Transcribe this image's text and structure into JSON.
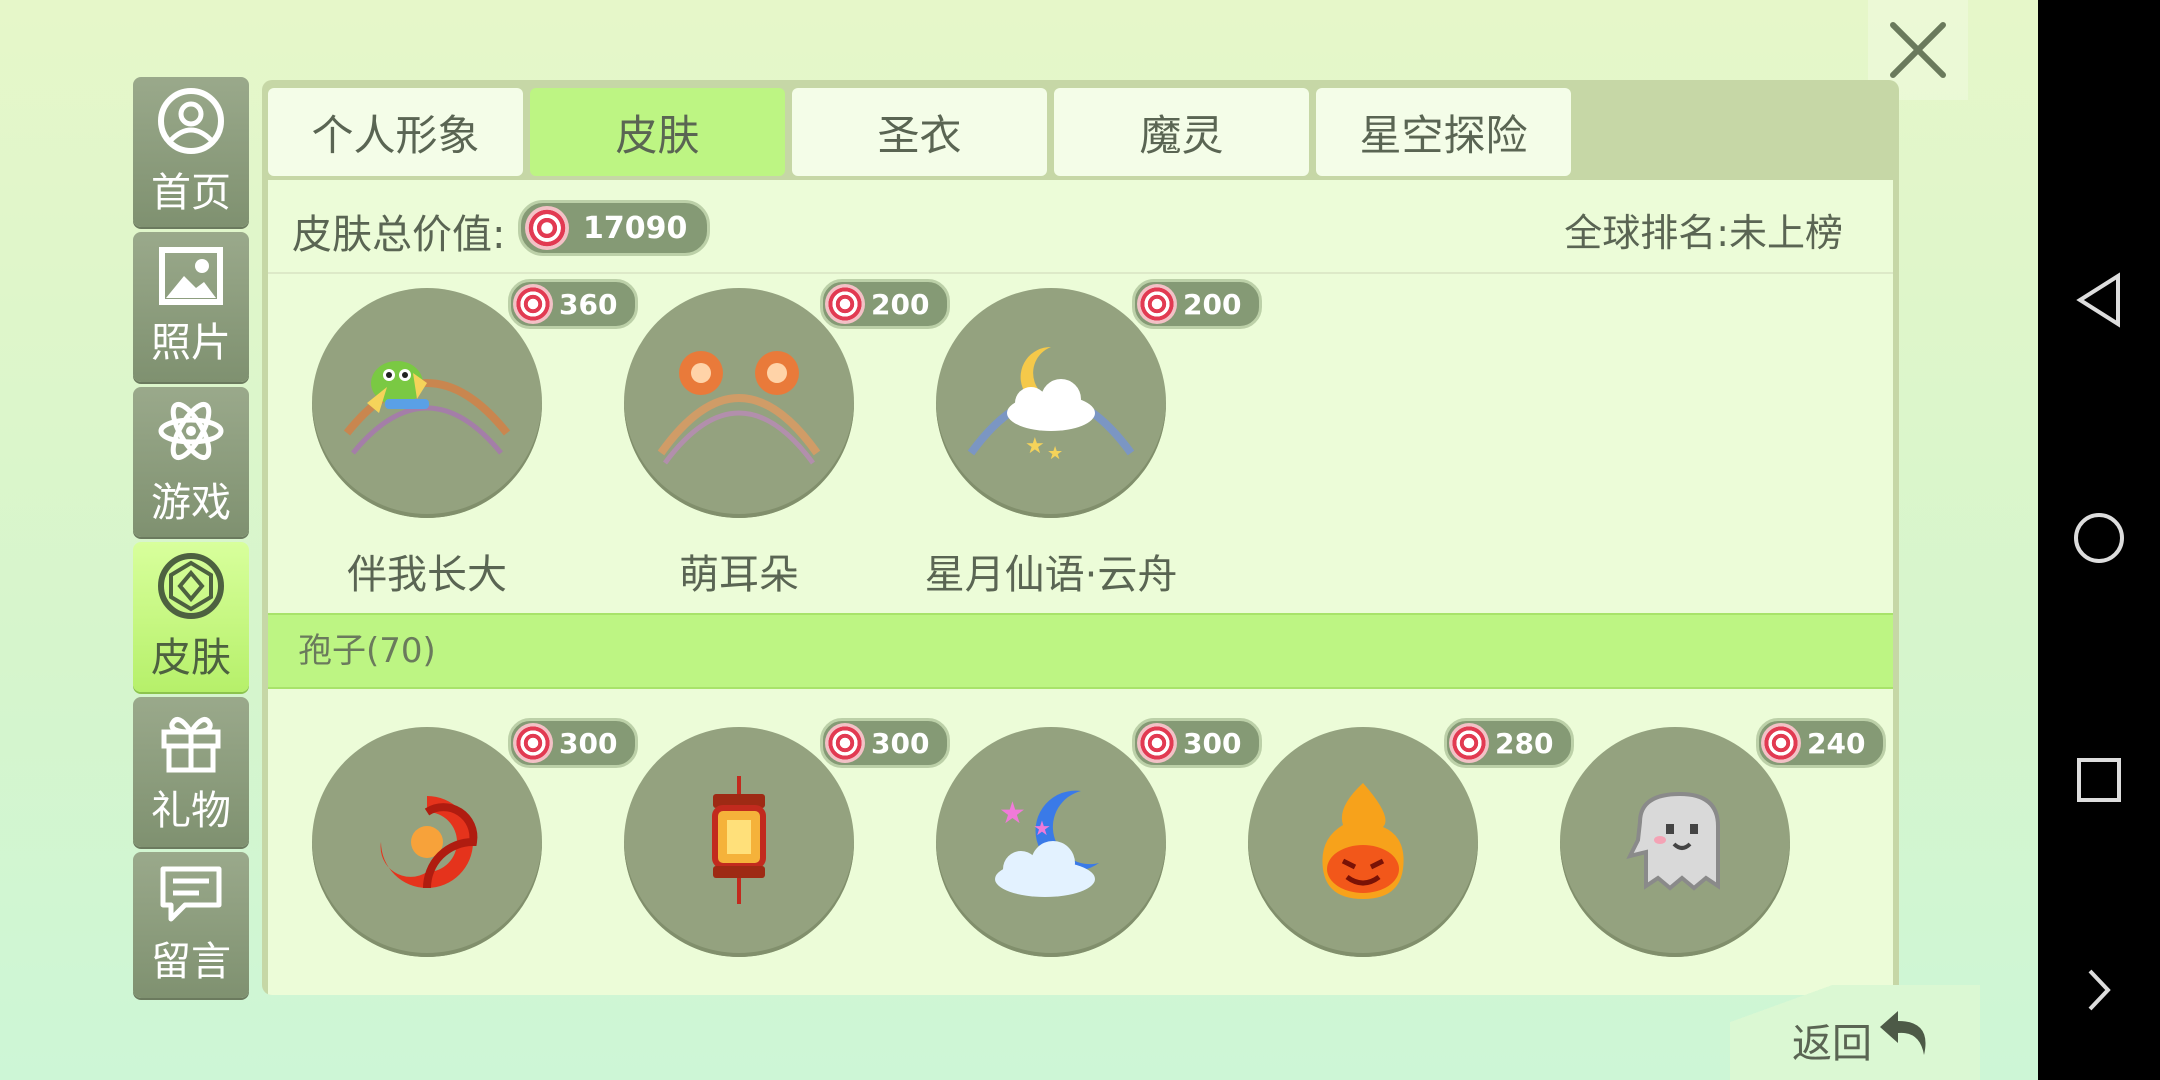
{
  "window": {
    "close_icon": "close-icon"
  },
  "sidebar": {
    "items": [
      {
        "label": "首页",
        "icon": "user-circle-icon"
      },
      {
        "label": "照片",
        "icon": "photo-icon"
      },
      {
        "label": "游戏",
        "icon": "atom-icon"
      },
      {
        "label": "皮肤",
        "icon": "gem-icon",
        "active": true
      },
      {
        "label": "礼物",
        "icon": "gift-icon"
      },
      {
        "label": "留言",
        "icon": "message-icon"
      }
    ]
  },
  "tabs": [
    {
      "label": "个人形象"
    },
    {
      "label": "皮肤",
      "active": true
    },
    {
      "label": "圣衣"
    },
    {
      "label": "魔灵"
    },
    {
      "label": "星空探险"
    }
  ],
  "summary": {
    "label": "皮肤总价值:",
    "value": "17090",
    "rank": "全球排名:未上榜"
  },
  "skins_top": [
    {
      "name": "伴我长大",
      "price": "360",
      "icon": "frog-planet-icon"
    },
    {
      "name": "萌耳朵",
      "price": "200",
      "icon": "bear-ears-icon"
    },
    {
      "name": "星月仙语·云舟",
      "price": "200",
      "icon": "moon-cloud-icon"
    }
  ],
  "section": {
    "label": "孢子(70)"
  },
  "spores": [
    {
      "price": "300",
      "icon": "red-swirl-icon"
    },
    {
      "price": "300",
      "icon": "lantern-icon"
    },
    {
      "price": "300",
      "icon": "sleepy-moon-icon"
    },
    {
      "price": "280",
      "icon": "fire-face-icon"
    },
    {
      "price": "240",
      "icon": "pixel-ghost-icon"
    }
  ],
  "back": {
    "label": "返回",
    "icon": "back-arrow-icon"
  },
  "colors": {
    "accent": "#bdf583",
    "panel": "#c6d7a6",
    "coin": "#e23a52"
  }
}
